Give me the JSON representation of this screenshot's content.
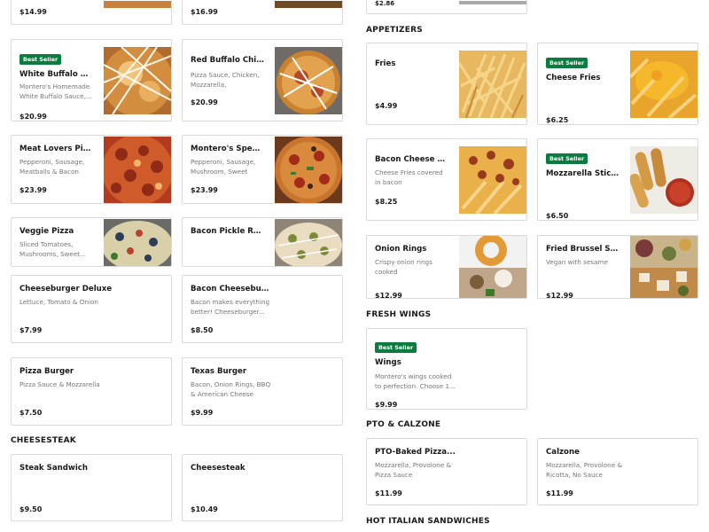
{
  "badge": "Best Seller",
  "top_prices": {
    "left": "$14.99",
    "middle": "$16.99",
    "right": "$2.86"
  },
  "left_items": [
    {
      "name": "White Buffalo Chicke...",
      "desc": "Montero's Homemade White Buffalo Sauce,...",
      "price": "$20.99",
      "best": true,
      "image": "white-buffalo-pizza"
    },
    {
      "name": "Red Buffalo Chicken...",
      "desc": "Pizza Sauce, Chicken, Mozzarella, Montero's...",
      "price": "$20.99",
      "best": false,
      "image": "red-buffalo-pizza"
    },
    {
      "name": "Meat Lovers Pizza",
      "desc": "Pepperoni, Sausage, Meatballs & Bacon",
      "price": "$23.99",
      "best": false,
      "image": "meat-lovers-pizza"
    },
    {
      "name": "Montero's Special Pizza",
      "desc": "Pepperoni, Sausage, Mushroom, Sweet Pepper...",
      "price": "$23.99",
      "best": false,
      "image": "special-pizza"
    },
    {
      "name": "Veggie Pizza",
      "desc": "Sliced Tomatoes, Mushrooms, Sweet...",
      "price": "",
      "best": false,
      "image": "veggie-pizza"
    },
    {
      "name": "Bacon Pickle Ranch...",
      "desc": "",
      "price": "",
      "best": false,
      "image": "pickle-pizza"
    },
    {
      "name": "Cheeseburger Deluxe",
      "desc": "Lettuce, Tomato & Onion",
      "price": "$7.99",
      "best": false
    },
    {
      "name": "Bacon Cheeseburger",
      "desc": "Bacon makes everything better! Cheeseburger...",
      "price": "$8.50",
      "best": false
    },
    {
      "name": "Pizza Burger",
      "desc": "Pizza Sauce & Mozzarella",
      "price": "$7.50",
      "best": false
    },
    {
      "name": "Texas Burger",
      "desc": "Bacon, Onion Rings, BBQ & American Cheese",
      "price": "$9.99",
      "best": false
    },
    {
      "name": "Steak Sandwich",
      "desc": "",
      "price": "$9.50",
      "best": false
    },
    {
      "name": "Cheesesteak",
      "desc": "",
      "price": "$10.49",
      "best": false
    }
  ],
  "sections": {
    "cheesesteak": "CHEESESTEAK",
    "appetizers": "APPETIZERS",
    "wings": "FRESH WINGS",
    "pto": "PTO & CALZONE",
    "hot_italian": "HOT ITALIAN SANDWICHES"
  },
  "right_items": [
    {
      "name": "Fries",
      "desc": "",
      "price": "$4.99",
      "best": false,
      "image": "fries"
    },
    {
      "name": "Cheese Fries",
      "desc": "",
      "price": "$6.25",
      "best": true,
      "image": "cheese-fries"
    },
    {
      "name": "Bacon Cheese Fries",
      "desc": "Cheese Fries covered in bacon",
      "price": "$8.25",
      "best": false,
      "image": "bacon-cheese-fries"
    },
    {
      "name": "Mozzarella Sticks",
      "desc": "",
      "price": "$6.50",
      "best": true,
      "image": "mozzarella-sticks"
    },
    {
      "name": "Onion Rings",
      "desc": "Crispy onion rings cooked",
      "price": "$12.99",
      "best": false,
      "image": "onion-rings"
    },
    {
      "name": "Fried Brussel Sprouts...",
      "desc": "Vegan with sesame",
      "price": "$12.99",
      "best": false,
      "image": "brussel-sprouts"
    },
    {
      "name": "Wings",
      "desc": "Montero's wings cooked to perfection. Choose 1...",
      "price": "$9.99",
      "best": true
    },
    {
      "name": "PTO-Baked Pizza...",
      "desc": "Mozzarella, Provolone & Pizza Sauce",
      "price": "$11.99",
      "best": false
    },
    {
      "name": "Calzone",
      "desc": "Mozzarella, Provolone & Ricotta, No Sauce",
      "price": "$11.99",
      "best": false
    }
  ],
  "colors": {
    "badge": "#0a7d3e",
    "border": "#d9d9d9",
    "muted": "#767676"
  }
}
